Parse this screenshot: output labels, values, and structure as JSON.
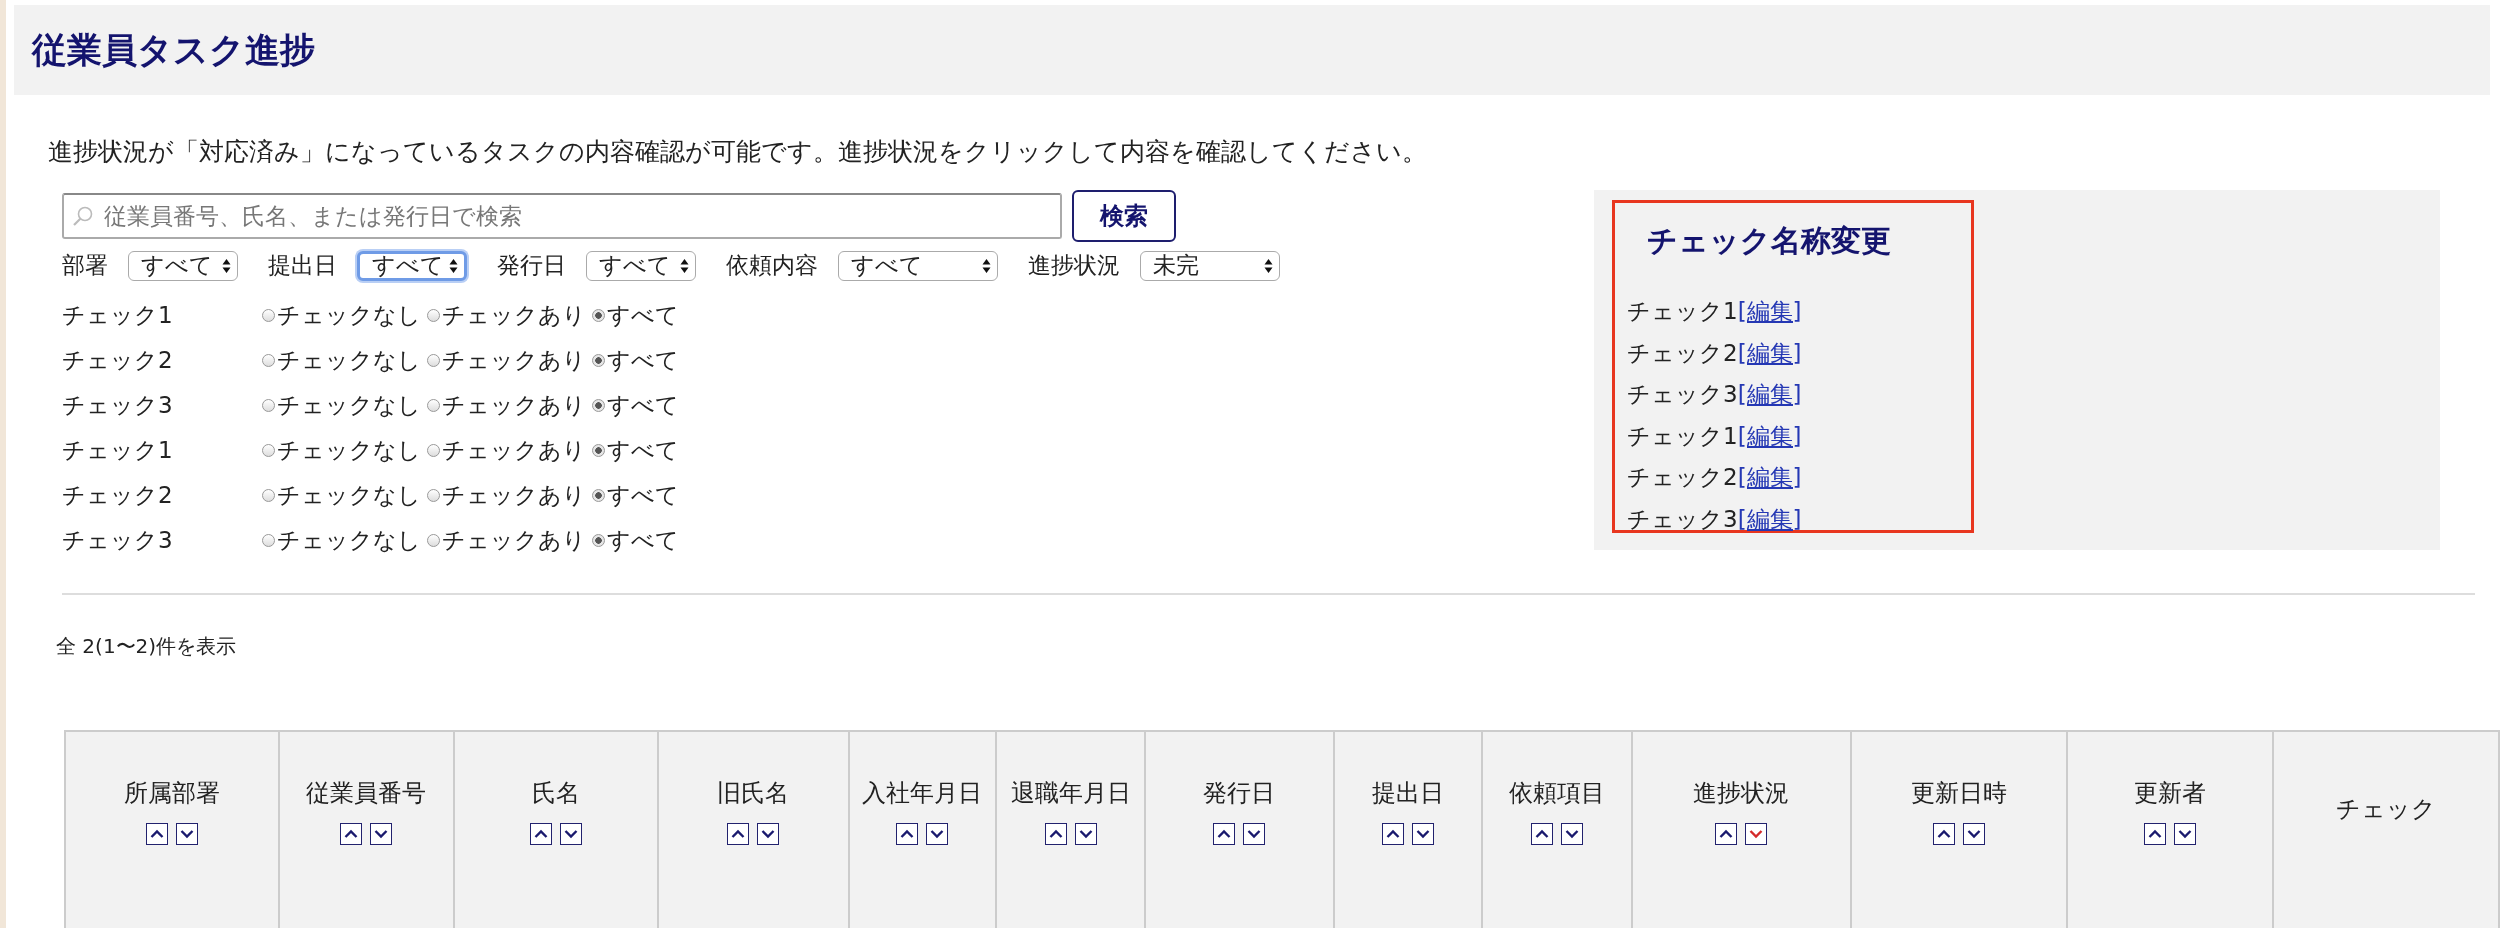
{
  "page": {
    "title": "従業員タスク進捗",
    "description": "進捗状況が「対応済み」になっているタスクの内容確認が可能です。進捗状況をクリックして内容を確認してください。"
  },
  "search": {
    "placeholder": "従業員番号、氏名、または発行日で検索",
    "button": "検索"
  },
  "filters": [
    {
      "label": "部署",
      "value": "すべて",
      "focused": false
    },
    {
      "label": "提出日",
      "value": "すべて",
      "focused": true
    },
    {
      "label": "発行日",
      "value": "すべて",
      "focused": false
    },
    {
      "label": "依頼内容",
      "value": "すべて",
      "focused": false
    },
    {
      "label": "進捗状況",
      "value": "未完",
      "focused": false
    }
  ],
  "check_filters": [
    {
      "label": "チェック1",
      "options": [
        {
          "label": "チェックなし",
          "selected": false
        },
        {
          "label": "チェックあり",
          "selected": false
        },
        {
          "label": "すべて",
          "selected": true
        }
      ]
    },
    {
      "label": "チェック2",
      "options": [
        {
          "label": "チェックなし",
          "selected": false
        },
        {
          "label": "チェックあり",
          "selected": false
        },
        {
          "label": "すべて",
          "selected": true
        }
      ]
    },
    {
      "label": "チェック3",
      "options": [
        {
          "label": "チェックなし",
          "selected": false
        },
        {
          "label": "チェックあり",
          "selected": false
        },
        {
          "label": "すべて",
          "selected": true
        }
      ]
    },
    {
      "label": "チェック1",
      "options": [
        {
          "label": "チェックなし",
          "selected": false
        },
        {
          "label": "チェックあり",
          "selected": false
        },
        {
          "label": "すべて",
          "selected": true
        }
      ]
    },
    {
      "label": "チェック2",
      "options": [
        {
          "label": "チェックなし",
          "selected": false
        },
        {
          "label": "チェックあり",
          "selected": false
        },
        {
          "label": "すべて",
          "selected": true
        }
      ]
    },
    {
      "label": "チェック3",
      "options": [
        {
          "label": "チェックなし",
          "selected": false
        },
        {
          "label": "チェックあり",
          "selected": false
        },
        {
          "label": "すべて",
          "selected": true
        }
      ]
    }
  ],
  "rename_panel": {
    "title": "チェック名称変更",
    "items": [
      {
        "name": "チェック1",
        "link": "[編集]"
      },
      {
        "name": "チェック2",
        "link": "[編集]"
      },
      {
        "name": "チェック3",
        "link": "[編集]"
      },
      {
        "name": "チェック1",
        "link": "[編集]"
      },
      {
        "name": "チェック2",
        "link": "[編集]"
      },
      {
        "name": "チェック3",
        "link": "[編集]"
      }
    ]
  },
  "result_count": "全 2(1〜2)件を表示",
  "table": {
    "columns": [
      {
        "label": "所属部署",
        "sort_asc": false,
        "sort_desc": false
      },
      {
        "label": "従業員番号",
        "sort_asc": false,
        "sort_desc": false
      },
      {
        "label": "氏名",
        "sort_asc": false,
        "sort_desc": false
      },
      {
        "label": "旧氏名",
        "sort_asc": false,
        "sort_desc": false
      },
      {
        "label": "入社年月日",
        "sort_asc": false,
        "sort_desc": false
      },
      {
        "label": "退職年月日",
        "sort_asc": false,
        "sort_desc": false
      },
      {
        "label": "発行日",
        "sort_asc": false,
        "sort_desc": false
      },
      {
        "label": "提出日",
        "sort_asc": false,
        "sort_desc": false
      },
      {
        "label": "依頼項目",
        "sort_asc": false,
        "sort_desc": false
      },
      {
        "label": "進捗状況",
        "sort_asc": false,
        "sort_desc": true
      },
      {
        "label": "更新日時",
        "sort_asc": false,
        "sort_desc": false
      },
      {
        "label": "更新者",
        "sort_asc": false,
        "sort_desc": false
      },
      {
        "label": "チェック"
      }
    ]
  }
}
